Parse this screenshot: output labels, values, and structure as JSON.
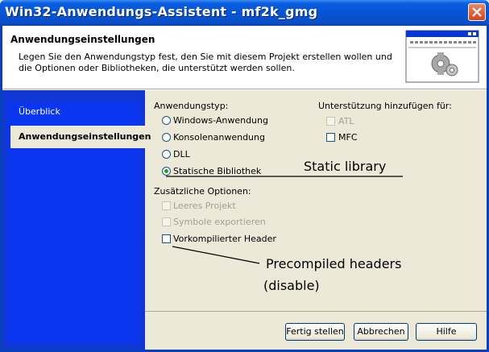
{
  "window": {
    "title": "Win32-Anwendungs-Assistent - mf2k_gmg",
    "close_icon": "close-icon"
  },
  "header": {
    "title": "Anwendungseinstellungen",
    "description": "Legen Sie den Anwendungstyp fest, den Sie mit diesem Projekt erstellen wollen und die Optionen oder Bibliotheken, die unterstützt werden sollen."
  },
  "sidebar": {
    "items": [
      {
        "label": "Überblick",
        "active": false
      },
      {
        "label": "Anwendungseinstellungen",
        "active": true
      }
    ]
  },
  "app_type": {
    "label": "Anwendungstyp:",
    "options": [
      {
        "label": "Windows-Anwendung",
        "checked": false
      },
      {
        "label": "Konsolenanwendung",
        "checked": false
      },
      {
        "label": "DLL",
        "checked": false
      },
      {
        "label": "Statische Bibliothek",
        "checked": true
      }
    ]
  },
  "support": {
    "label": "Unterstützung hinzufügen für:",
    "options": [
      {
        "label": "ATL",
        "checked": false,
        "enabled": false
      },
      {
        "label": "MFC",
        "checked": false,
        "enabled": true
      }
    ]
  },
  "additional": {
    "label": "Zusätzliche Optionen:",
    "options": [
      {
        "label": "Leeres Projekt",
        "checked": false,
        "enabled": false
      },
      {
        "label": "Symbole exportieren",
        "checked": false,
        "enabled": false
      },
      {
        "label": "Vorkompilierter Header",
        "checked": false,
        "enabled": true
      }
    ]
  },
  "annotations": {
    "static_library": "Static library",
    "precompiled_line1": "Precompiled headers",
    "precompiled_line2": "(disable)"
  },
  "buttons": {
    "finish": "Fertig stellen",
    "cancel": "Abbrechen",
    "help": "Hilfe"
  }
}
